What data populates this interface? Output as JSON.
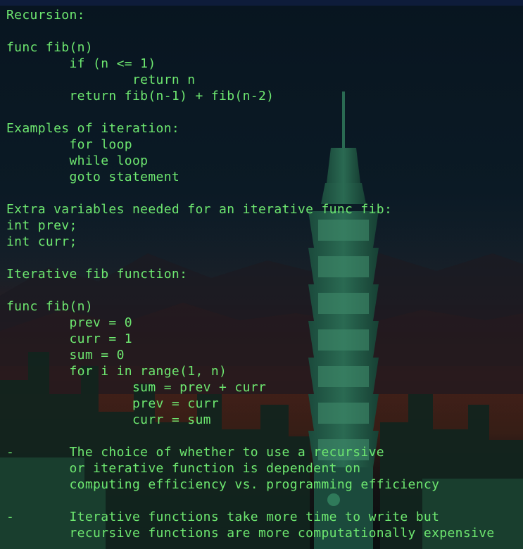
{
  "colors": {
    "text": "#6ee870",
    "background": "#07131a",
    "top_bar": "#0e1c3a"
  },
  "terminal": {
    "lines": [
      "Recursion:",
      "",
      "func fib(n)",
      "        if (n <= 1)",
      "                return n",
      "        return fib(n-1) + fib(n-2)",
      "",
      "Examples of iteration:",
      "        for loop",
      "        while loop",
      "        goto statement",
      "",
      "Extra variables needed for an iterative func fib:",
      "int prev;",
      "int curr;",
      "",
      "Iterative fib function:",
      "",
      "func fib(n)",
      "        prev = 0",
      "        curr = 1",
      "        sum = 0",
      "        for i in range(1, n)",
      "                sum = prev + curr",
      "                prev = curr",
      "                curr = sum",
      "",
      "-       The choice of whether to use a recursive",
      "        or iterative function is dependent on",
      "        computing efficiency vs. programming efficiency",
      "",
      "-       Iterative functions take more time to write but",
      "        recursive functions are more computationally expensive"
    ]
  }
}
